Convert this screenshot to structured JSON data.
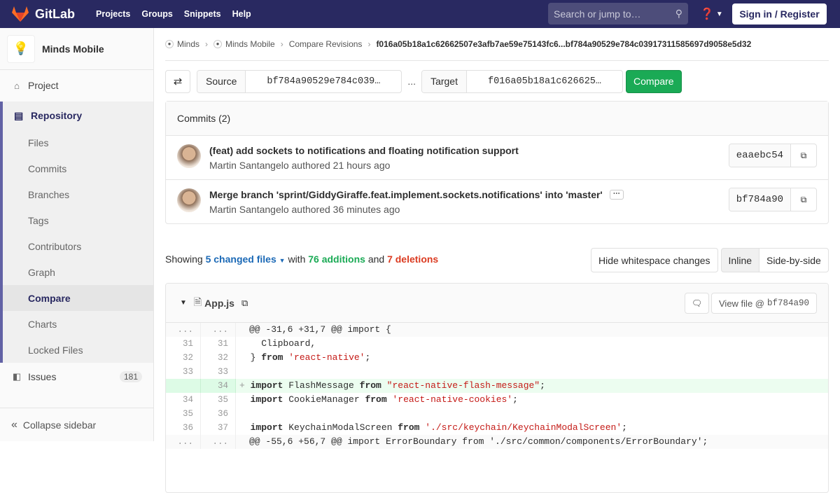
{
  "topbar": {
    "brand": "GitLab",
    "nav": [
      "Projects",
      "Groups",
      "Snippets",
      "Help"
    ],
    "search_placeholder": "Search or jump to…",
    "signin": "Sign in / Register"
  },
  "sidebar": {
    "project": "Minds Mobile",
    "project_item": "Project",
    "repository": "Repository",
    "items": [
      "Files",
      "Commits",
      "Branches",
      "Tags",
      "Contributors",
      "Graph",
      "Compare",
      "Charts",
      "Locked Files"
    ],
    "active": "Compare",
    "issues": "Issues",
    "issues_count": "181",
    "collapse": "Collapse sidebar"
  },
  "breadcrumb": {
    "items": [
      "Minds",
      "Minds Mobile",
      "Compare Revisions"
    ],
    "current": "f016a05b18a1c62662507e3afb7ae59e75143fc6...bf784a90529e784c03917311585697d9058e5d32"
  },
  "compare": {
    "source_label": "Source",
    "source_value": "bf784a90529e784c039…",
    "dots": "...",
    "target_label": "Target",
    "target_value": "f016a05b18a1c626625…",
    "button": "Compare"
  },
  "commits": {
    "header": "Commits (2)",
    "items": [
      {
        "title": "(feat) add sockets to notifications and floating notification support",
        "meta": "Martin Santangelo authored 21 hours ago",
        "sha": "eaaebc54"
      },
      {
        "title": "Merge branch 'sprint/GiddyGiraffe.feat.implement.sockets.notifications' into 'master'",
        "meta": "Martin Santangelo authored 36 minutes ago",
        "sha": "bf784a90"
      }
    ]
  },
  "stats": {
    "showing": "Showing",
    "files": "5 changed files",
    "with": "with",
    "additions": "76 additions",
    "and": "and",
    "deletions": "7 deletions"
  },
  "view_buttons": {
    "whitespace": "Hide whitespace changes",
    "inline": "Inline",
    "side": "Side-by-side"
  },
  "file": {
    "name": "App.js",
    "view_label": "View file @",
    "view_sha": "bf784a90"
  },
  "diff": [
    {
      "o": "...",
      "n": "...",
      "t": "hunk",
      "code": "@@ -31,6 +31,7 @@ import {"
    },
    {
      "o": "31",
      "n": "31",
      "t": "ctx",
      "code": "  Clipboard,"
    },
    {
      "o": "32",
      "n": "32",
      "t": "ctx",
      "code": "} from 'react-native';"
    },
    {
      "o": "33",
      "n": "33",
      "t": "ctx",
      "code": ""
    },
    {
      "o": "",
      "n": "34",
      "t": "add",
      "code": "import FlashMessage from \"react-native-flash-message\";"
    },
    {
      "o": "34",
      "n": "35",
      "t": "ctx",
      "code": "import CookieManager from 'react-native-cookies';"
    },
    {
      "o": "35",
      "n": "36",
      "t": "ctx",
      "code": ""
    },
    {
      "o": "36",
      "n": "37",
      "t": "ctx",
      "code": "import KeychainModalScreen from './src/keychain/KeychainModalScreen';"
    },
    {
      "o": "...",
      "n": "...",
      "t": "hunk",
      "code": "@@ -55,6 +56,7 @@ import ErrorBoundary from './src/common/components/ErrorBoundary';"
    }
  ]
}
